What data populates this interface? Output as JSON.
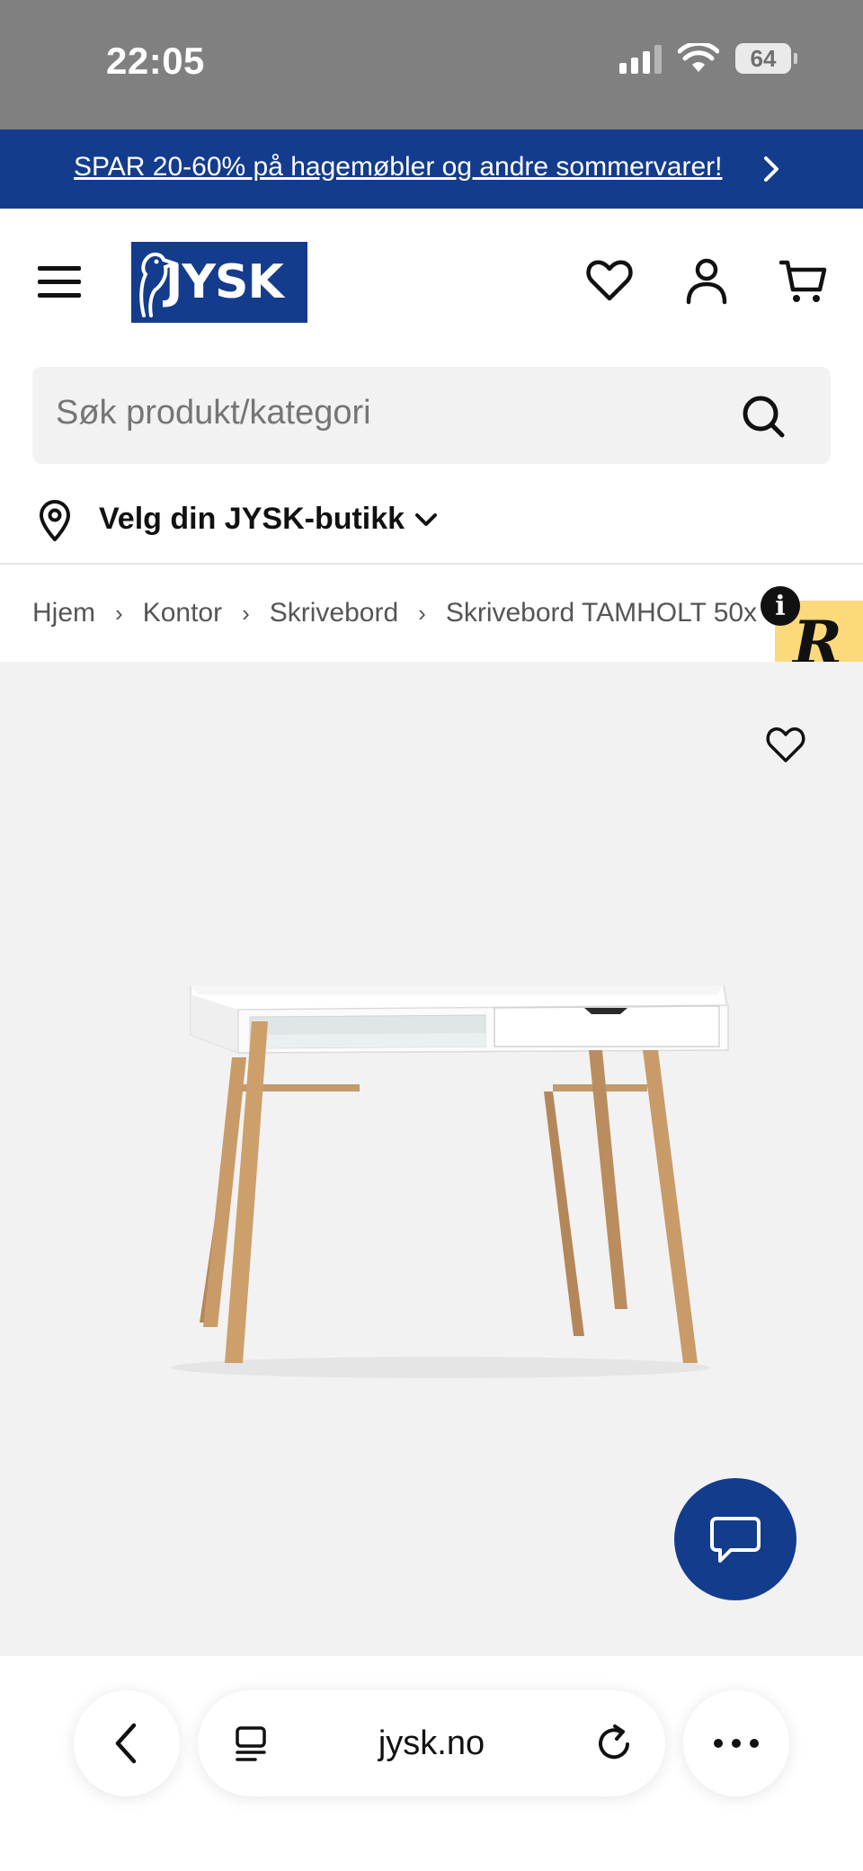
{
  "status_bar": {
    "time": "22:05",
    "battery": "64",
    "icons": [
      "cellular-signal-icon",
      "wifi-icon",
      "battery-icon"
    ]
  },
  "promo": {
    "text": "SPAR 20-60% på hagemøbler og andre sommervarer!",
    "icon": "chevron-right-icon"
  },
  "header": {
    "logo": "JYSK",
    "icons": [
      "menu-icon",
      "heart-icon",
      "user-icon",
      "cart-icon"
    ]
  },
  "search": {
    "placeholder": "Søk produkt/kategori",
    "icon": "search-icon"
  },
  "store": {
    "label": "Velg din JYSK-butikk",
    "icon": "location-pin-icon"
  },
  "breadcrumb": {
    "items": [
      "Hjem",
      "Kontor",
      "Skrivebord",
      "Skrivebord TAMHOLT 50x"
    ],
    "separator": "›"
  },
  "badge": {
    "letter": "R",
    "info": "i"
  },
  "browser": {
    "url": "jysk.no",
    "icons": [
      "back-icon",
      "tabs-icon",
      "reload-icon",
      "more-icon"
    ]
  },
  "colors": {
    "brand_blue": "#143c8c",
    "status_gray": "#808080",
    "badge_yellow": "#fcd97a",
    "product_bg": "#f3f2f2"
  }
}
